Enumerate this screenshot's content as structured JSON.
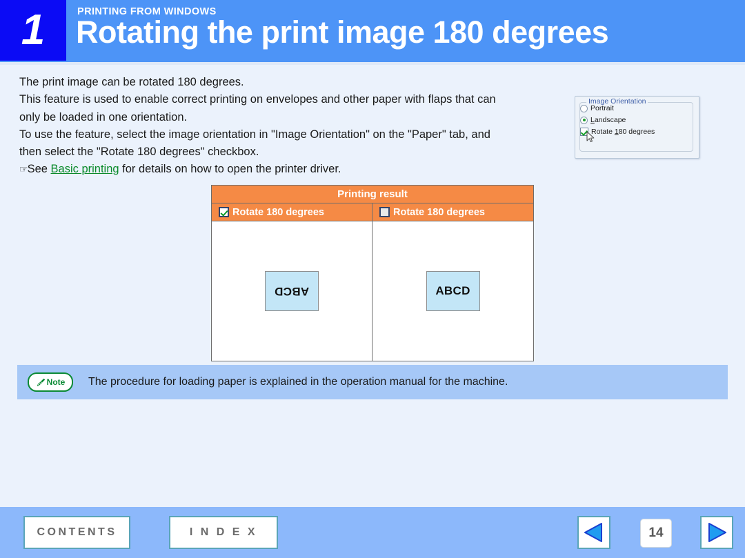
{
  "header": {
    "chapter_number": "1",
    "eyebrow": "PRINTING FROM WINDOWS",
    "title": "Rotating the print image 180 degrees",
    "badge_color": "#0b0bf5",
    "band_color": "#4d94f7"
  },
  "body": {
    "line1": "The print image can be rotated 180 degrees.",
    "line2": "This feature is used to enable correct printing on envelopes and other paper with flaps that can",
    "line3": "only be loaded in one orientation.",
    "line4": "To use the feature, select the image orientation in \"Image Orientation\" on the \"Paper\" tab, and",
    "line5": "then select the \"Rotate 180 degrees\" checkbox.",
    "hand_glyph": "☞",
    "see_prefix": "See ",
    "link_text": "Basic printing",
    "see_suffix": " for details on how to open the printer driver.",
    "link_color": "#0a8a2a"
  },
  "dialog": {
    "group_title": "Image Orientation",
    "options": [
      {
        "label": "Portrait",
        "type": "radio",
        "selected": false
      },
      {
        "label_pre": "",
        "label_accel": "L",
        "label_post": "andscape",
        "type": "radio",
        "selected": true
      },
      {
        "label_pre": "Rotate ",
        "label_accel": "1",
        "label_post": "80 degrees",
        "type": "checkbox",
        "selected": true
      }
    ],
    "title_color": "#3f5fa8"
  },
  "table": {
    "title": "Printing result",
    "title_bg": "#f58a45",
    "columns": [
      {
        "label": "Rotate 180 degrees",
        "checked": true,
        "sample": "ABCD",
        "rotated": true
      },
      {
        "label": "Rotate 180 degrees",
        "checked": false,
        "sample": "ABCD",
        "rotated": false
      }
    ]
  },
  "note": {
    "badge_label": "Note",
    "badge_color": "#0b8a35",
    "text": "The procedure for loading paper is explained in the operation manual for the machine.",
    "bg_color": "#a6c8f7"
  },
  "footer": {
    "contents_label": "CONTENTS",
    "index_label": "I N D E X",
    "page_number": "14",
    "prev_icon": "prev-arrow-icon",
    "next_icon": "next-arrow-icon",
    "bg_color": "#8cb8fb"
  }
}
